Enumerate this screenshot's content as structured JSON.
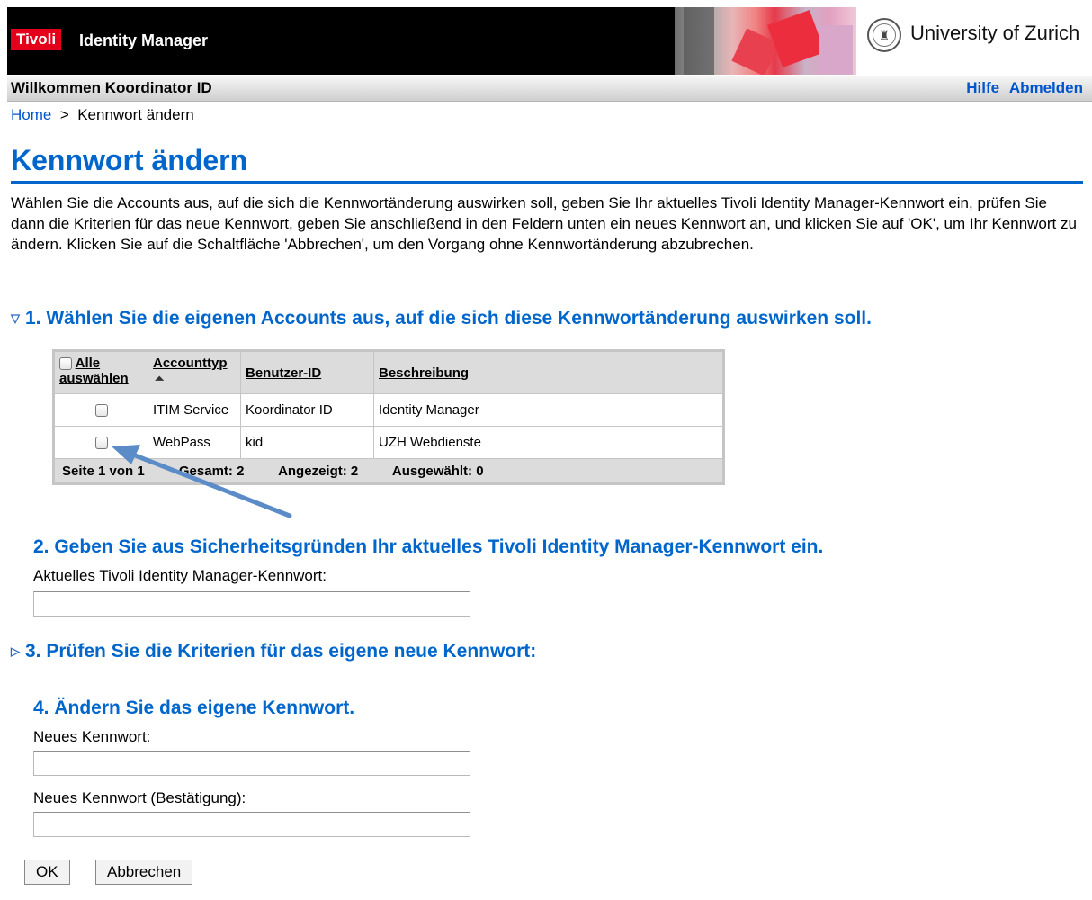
{
  "header": {
    "brand": "Tivoli",
    "product": "Identity Manager",
    "university": "University of Zurich",
    "welcome": "Willkommen Koordinator ID",
    "links": {
      "help": "Hilfe",
      "logout": "Abmelden"
    }
  },
  "breadcrumb": {
    "home": "Home",
    "separator": ">",
    "current": "Kennwort ändern"
  },
  "page": {
    "title": "Kennwort ändern",
    "intro": "Wählen Sie die Accounts aus, auf die sich die Kennwortänderung auswirken soll, geben Sie Ihr aktuelles Tivoli Identity Manager-Kennwort ein, prüfen Sie dann die Kriterien für das neue Kennwort, geben Sie anschließend in den Feldern unten ein neues Kennwort an, und klicken Sie auf 'OK', um Ihr Kennwort zu ändern. Klicken Sie auf die Schaltfläche 'Abbrechen', um den Vorgang ohne Kennwortänderung abzubrechen."
  },
  "section1": {
    "title": "1. Wählen Sie die eigenen Accounts aus, auf die sich diese Kennwortänderung auswirken soll.",
    "table": {
      "headers": {
        "select_all_1": "Alle",
        "select_all_2": "auswählen",
        "account_type": "Accounttyp",
        "user_id": "Benutzer-ID",
        "description": "Beschreibung"
      },
      "rows": [
        {
          "account_type": "ITIM Service",
          "user_id": "Koordinator ID",
          "description": "Identity Manager"
        },
        {
          "account_type": "WebPass",
          "user_id": "kid",
          "description": "UZH Webdienste"
        }
      ],
      "footer": {
        "page": "Seite 1 von 1",
        "total": "Gesamt: 2",
        "shown": "Angezeigt: 2",
        "selected": "Ausgewählt: 0"
      }
    }
  },
  "section2": {
    "title": "2. Geben Sie aus Sicherheitsgründen Ihr aktuelles Tivoli Identity Manager-Kennwort ein.",
    "label": "Aktuelles Tivoli Identity Manager-Kennwort:",
    "value": ""
  },
  "section3": {
    "title": "3. Prüfen Sie die Kriterien für das eigene neue Kennwort:"
  },
  "section4": {
    "title": "4. Ändern Sie das eigene Kennwort.",
    "new_label": "Neues Kennwort:",
    "new_value": "",
    "confirm_label": "Neues Kennwort (Bestätigung):",
    "confirm_value": ""
  },
  "buttons": {
    "ok": "OK",
    "cancel": "Abbrechen"
  },
  "colors": {
    "brand_red": "#e4001b",
    "heading_blue": "#0066cc",
    "link_blue": "#0055cc",
    "arrow": "#5b8cc8"
  }
}
